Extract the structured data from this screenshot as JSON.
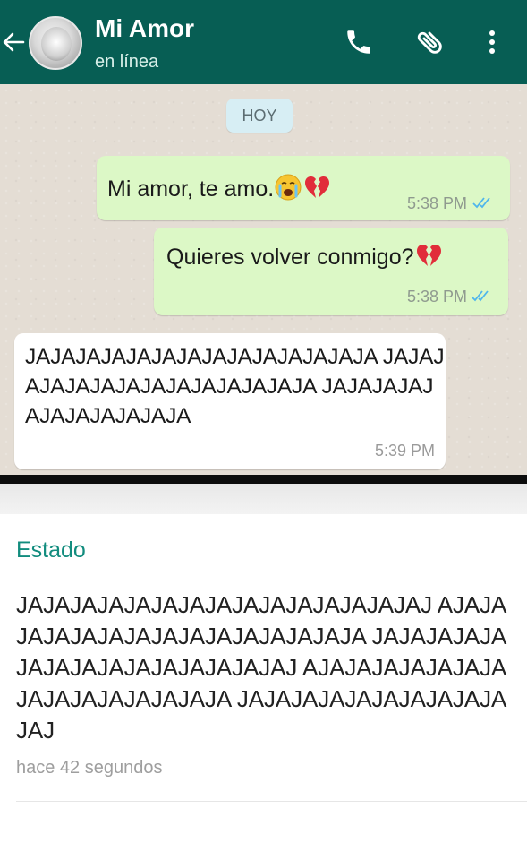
{
  "header": {
    "contact_name": "Mi Amor",
    "status": "en línea",
    "background_color": "#075e54",
    "icons": [
      "back-arrow-icon",
      "avatar",
      "phone-icon",
      "paperclip-icon",
      "more-vert-icon"
    ]
  },
  "chat": {
    "date_label": "HOY",
    "messages": [
      {
        "direction": "outgoing",
        "text": "Mi amor, te amo.",
        "emojis": [
          "crying-face-icon",
          "broken-heart-icon"
        ],
        "time": "5:38 PM",
        "read": true
      },
      {
        "direction": "outgoing",
        "text": "Quieres volver conmigo?",
        "emojis": [
          "broken-heart-icon"
        ],
        "time": "5:38 PM",
        "read": true
      },
      {
        "direction": "incoming",
        "text": "JAJAJAJAJAJAJAJAJAJAJAJAJAJA JAJAJAJAJAJAJAJAJAJAJAJAJAJA JAJAJAJAJAJAJAJAJAJAJA",
        "time": "5:39 PM"
      }
    ],
    "colors": {
      "outgoing_bubble": "#dcf8c6",
      "incoming_bubble": "#ffffff",
      "read_ticks": "#4fb6ec"
    }
  },
  "status_card": {
    "label": "Estado",
    "text": "JAJAJAJAJAJAJAJAJAJAJAJAJAJAJAJ AJAJAJAJAJAJAJAJAJAJAJAJAJAJAJA JAJAJAJAJAJAJAJAJAJAJAJAJAJAJAJ AJAJAJAJAJAJAJAJAJAJAJAJAJAJAJA JAJAJAJAJAJAJAJAJAJAJAJ",
    "time_ago": "hace 42 segundos",
    "label_color": "#128c7e"
  }
}
